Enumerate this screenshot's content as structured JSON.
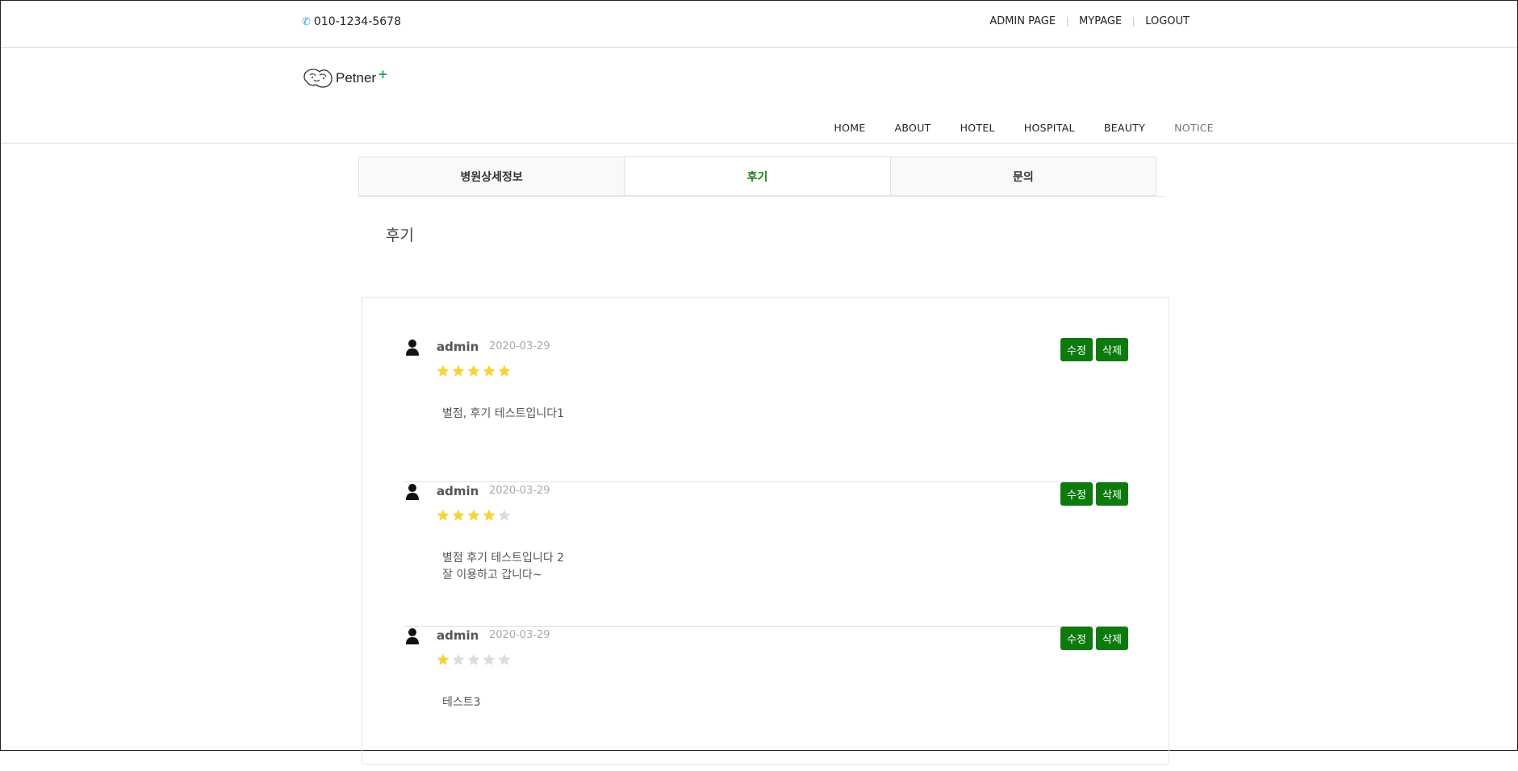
{
  "topbar": {
    "phone": "010-1234-5678",
    "links": [
      "ADMIN PAGE",
      "MYPAGE",
      "LOGOUT"
    ]
  },
  "logo": {
    "text": "Petner",
    "plus": "+"
  },
  "nav": {
    "items": [
      "HOME",
      "ABOUT",
      "HOTEL",
      "HOSPITAL",
      "BEAUTY",
      "NOTICE"
    ]
  },
  "tabs": [
    {
      "label": "병원상세정보",
      "active": false
    },
    {
      "label": "후기",
      "active": true
    },
    {
      "label": "문의",
      "active": false
    }
  ],
  "section_title": "후기",
  "colors": {
    "accent_green": "#0d7a0d",
    "star_on": "#f5d33a",
    "star_off": "#dcdcdc"
  },
  "reviews": [
    {
      "author": "admin",
      "date": "2020-03-29",
      "rating": 5,
      "content": [
        "별점, 후기 테스트입니다1"
      ],
      "edit_label": "수정",
      "delete_label": "삭제"
    },
    {
      "author": "admin",
      "date": "2020-03-29",
      "rating": 4,
      "content": [
        "별점 후기 테스트입니다 2",
        "잘 이용하고 갑니다~"
      ],
      "edit_label": "수정",
      "delete_label": "삭제"
    },
    {
      "author": "admin",
      "date": "2020-03-29",
      "rating": 1,
      "content": [
        "테스트3"
      ],
      "edit_label": "수정",
      "delete_label": "삭제"
    }
  ]
}
